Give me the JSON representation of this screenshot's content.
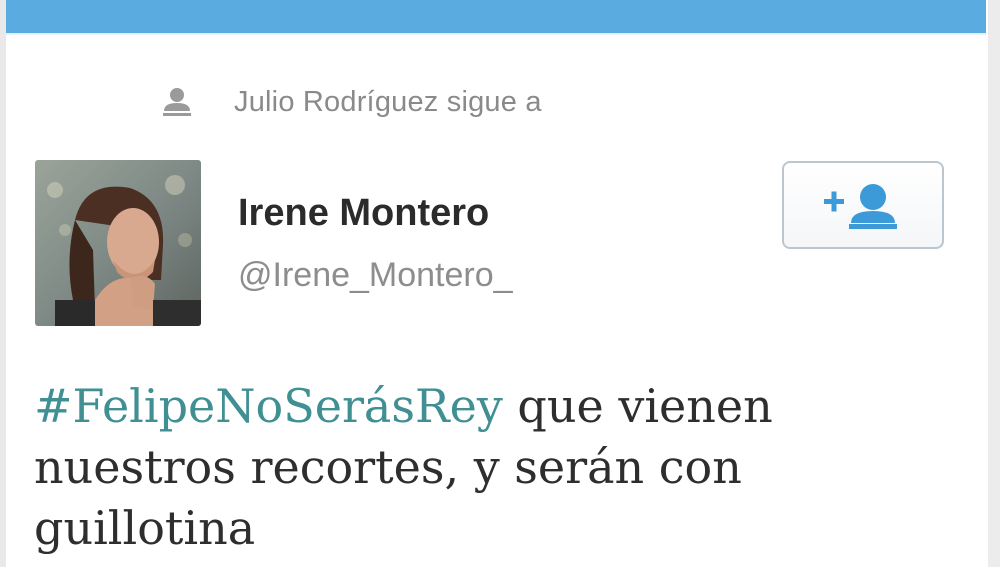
{
  "context": {
    "text": "Julio Rodríguez sigue a",
    "icon": "person-icon"
  },
  "profile": {
    "name": "Irene Montero",
    "handle": "@Irene_Montero_"
  },
  "follow_button": {
    "icon": "follow-user-icon"
  },
  "tweet": {
    "hashtag": "#FelipeNoSerásRey",
    "text": " que vienen nuestros recortes, y serán con guillotina"
  },
  "colors": {
    "top_bar": "#5aabdf",
    "hashtag": "#3f8f93",
    "follow_icon": "#3d9ad8"
  }
}
